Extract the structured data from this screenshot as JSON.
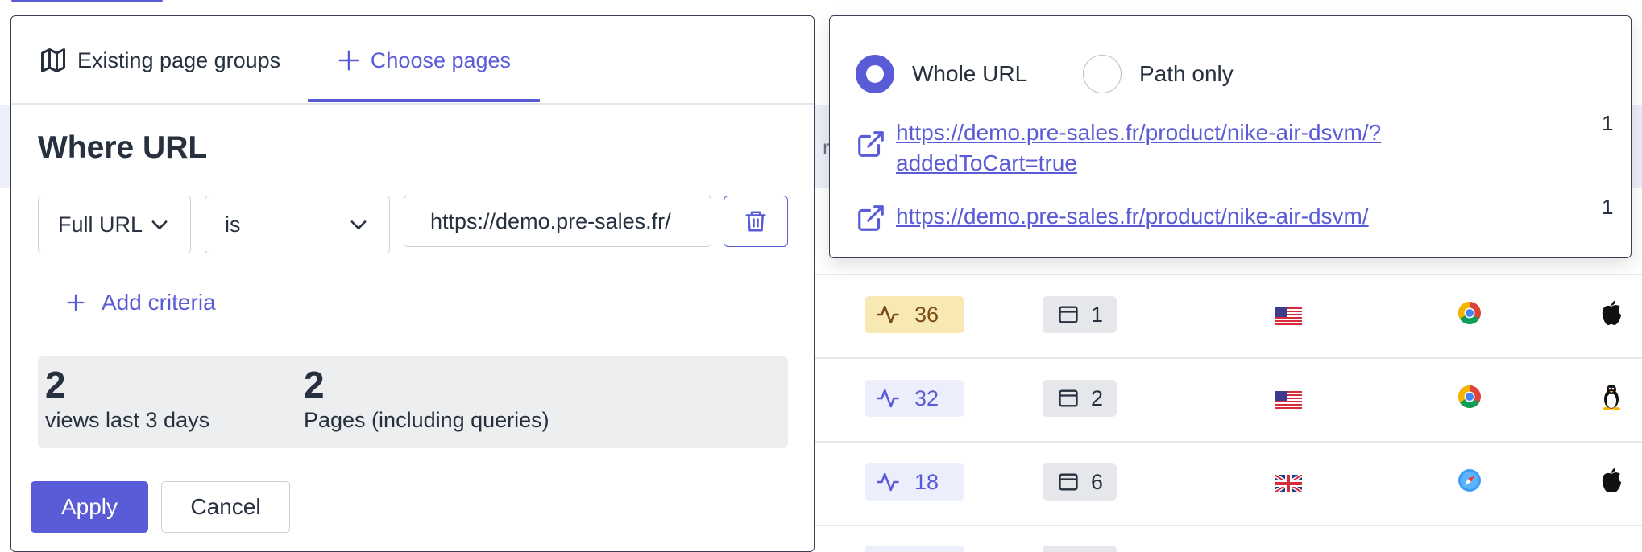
{
  "left_panel": {
    "tabs": [
      {
        "label": "Existing page groups",
        "icon": "map-icon"
      },
      {
        "label": "Choose pages",
        "icon": "plus-icon",
        "active": true
      }
    ],
    "title": "Where URL",
    "criteria": {
      "field": "Full URL",
      "operator": "is",
      "value": "https://demo.pre-sales.fr/"
    },
    "add_criteria_label": "Add criteria",
    "stats": [
      {
        "value": "2",
        "label": "views last 3 days"
      },
      {
        "value": "2",
        "label": "Pages (including queries)"
      }
    ],
    "apply_label": "Apply",
    "cancel_label": "Cancel"
  },
  "right_panel": {
    "match_mode": {
      "options": [
        "Whole URL",
        "Path only"
      ],
      "selected": "Whole URL"
    },
    "urls": [
      {
        "line1": "https://demo.pre-sales.fr/product/nike-air-dsvm/?",
        "line2": "addedToCart=true",
        "count": "1"
      },
      {
        "line1": "https://demo.pre-sales.fr/product/nike-air-dsvm/",
        "line2": "",
        "count": "1"
      }
    ]
  },
  "background_table": {
    "partial_header_text": "r",
    "rows": [
      {
        "views": "36",
        "pages": "1",
        "country": "us-flag",
        "browser": "chrome-icon",
        "os": "apple-icon",
        "tone": "warm"
      },
      {
        "views": "32",
        "pages": "2",
        "country": "us-flag",
        "browser": "chrome-icon",
        "os": "linux-icon",
        "tone": "cool"
      },
      {
        "views": "18",
        "pages": "6",
        "country": "uk-flag",
        "browser": "safari-icon",
        "os": "apple-icon",
        "tone": "cool"
      }
    ]
  },
  "colors": {
    "accent": "#5a5bd6",
    "text": "#27303f",
    "warm_badge": "#f7e8b4",
    "cool_badge": "#eceefc"
  }
}
